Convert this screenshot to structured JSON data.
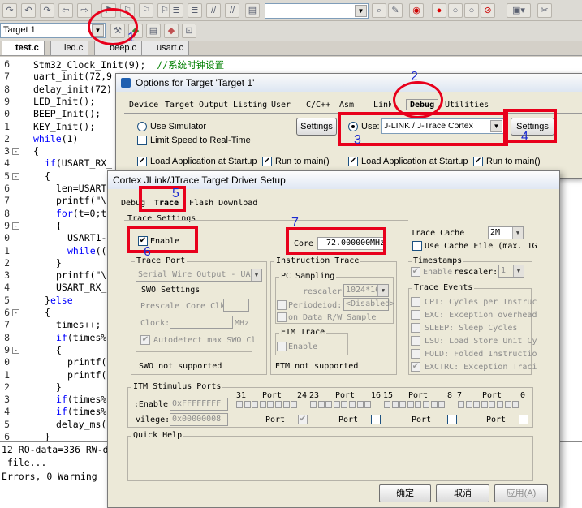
{
  "ide": {
    "target_select": "Target 1",
    "file_tabs": [
      "test.c",
      "led.c",
      "beep.c",
      "usart.c"
    ],
    "active_tab": "test.c",
    "code_lines": [
      {
        "ln": "6",
        "fold": "",
        "pre": "Stm32_Clock_Init(9);  ",
        "cm": "//系统时钟设置"
      },
      {
        "ln": "7",
        "fold": "",
        "pre": "uart_init(72,9",
        "cm": ""
      },
      {
        "ln": "8",
        "fold": "",
        "pre": "delay_init(72)",
        "cm": ""
      },
      {
        "ln": "9",
        "fold": "",
        "pre": "LED_Init();",
        "cm": ""
      },
      {
        "ln": "0",
        "fold": "",
        "pre": "BEEP_Init();",
        "cm": ""
      },
      {
        "ln": "1",
        "fold": "",
        "pre": "KEY_Init();",
        "cm": ""
      },
      {
        "ln": "2",
        "fold": "",
        "kw": "while",
        "pre": "(1)",
        "cm": ""
      },
      {
        "ln": "3",
        "fold": "-",
        "pre": "{",
        "cm": ""
      },
      {
        "ln": "4",
        "fold": "",
        "kw": "if",
        "pre": "(USART_RX_",
        "cm": "",
        "indent": 2
      },
      {
        "ln": "5",
        "fold": "-",
        "pre": "{",
        "cm": "",
        "indent": 2
      },
      {
        "ln": "6",
        "fold": "",
        "pre": "len=USART",
        "cm": "",
        "indent": 4
      },
      {
        "ln": "7",
        "fold": "",
        "pre": "printf(\"\\",
        "cm": "",
        "indent": 4
      },
      {
        "ln": "8",
        "fold": "",
        "kw": "for",
        "pre": "(t=0;t",
        "cm": "",
        "indent": 4
      },
      {
        "ln": "9",
        "fold": "-",
        "pre": "{",
        "cm": "",
        "indent": 4
      },
      {
        "ln": "0",
        "fold": "",
        "pre": "USART1-",
        "cm": "",
        "indent": 6
      },
      {
        "ln": "1",
        "fold": "",
        "kw": "while",
        "pre": "((",
        "cm": "",
        "indent": 6
      },
      {
        "ln": "2",
        "fold": "",
        "pre": "}",
        "cm": "",
        "indent": 4
      },
      {
        "ln": "3",
        "fold": "",
        "pre": "printf(\"\\",
        "cm": "",
        "indent": 4
      },
      {
        "ln": "4",
        "fold": "",
        "pre": "USART_RX_",
        "cm": "",
        "indent": 4
      },
      {
        "ln": "5",
        "fold": "",
        "pre": "}",
        "kw2": "else",
        "cm": "",
        "indent": 2
      },
      {
        "ln": "6",
        "fold": "-",
        "pre": "{",
        "cm": "",
        "indent": 2
      },
      {
        "ln": "7",
        "fold": "",
        "pre": "times++;",
        "cm": "",
        "indent": 4
      },
      {
        "ln": "8",
        "fold": "",
        "kw": "if",
        "pre": "(times%",
        "cm": "",
        "indent": 4
      },
      {
        "ln": "9",
        "fold": "-",
        "pre": "{",
        "cm": "",
        "indent": 4
      },
      {
        "ln": "0",
        "fold": "",
        "pre": "printf(",
        "cm": "",
        "indent": 6
      },
      {
        "ln": "1",
        "fold": "",
        "pre": "printf(",
        "cm": "",
        "indent": 6
      },
      {
        "ln": "2",
        "fold": "",
        "pre": "}",
        "cm": "",
        "indent": 4
      },
      {
        "ln": "3",
        "fold": "",
        "kw": "if",
        "pre": "(times%",
        "cm": "",
        "indent": 4
      },
      {
        "ln": "4",
        "fold": "",
        "kw": "if",
        "pre": "(times%",
        "cm": "",
        "indent": 4
      },
      {
        "ln": "5",
        "fold": "",
        "pre": "delay_ms(",
        "cm": "",
        "indent": 4
      },
      {
        "ln": "6",
        "fold": "",
        "pre": "}",
        "cm": "",
        "indent": 2
      }
    ],
    "build_output": [
      "12 RO-data=336 RW-d",
      " file...",
      "Errors, 0 Warning"
    ]
  },
  "options_dialog": {
    "title": "Options for Target 'Target 1'",
    "tabs": [
      "Device",
      "Target",
      "Output",
      "Listing",
      "User",
      "C/C++",
      "Asm",
      "Linker",
      "Debug",
      "Utilities"
    ],
    "active_tab": "Debug",
    "use_simulator": "Use Simulator",
    "limit_speed": "Limit Speed to Real-Time",
    "settings_left": "Settings",
    "use_label": "Use:",
    "debugger": "J-LINK / J-Trace Cortex",
    "settings_right": "Settings",
    "load_app_left": "Load Application at Startup",
    "run_main_left": "Run to main()",
    "load_app_right": "Load Application at Startup",
    "run_main_right": "Run to main()"
  },
  "jlink_dialog": {
    "title": "Cortex JLink/JTrace Target Driver Setup",
    "tabs": [
      "Debug",
      "Trace",
      "Flash Download"
    ],
    "active_tab": "Trace",
    "trace_settings": "Trace Settings",
    "enable": "Enable",
    "core_label": "Core",
    "core_value": "72.000000",
    "core_unit": "MHz",
    "trace_cache": "Trace Cache",
    "trace_cache_value": "2M",
    "use_cache_file": "Use Cache File (max. 1G",
    "trace_port": "Trace Port",
    "trace_port_value": "Serial Wire Output - UA",
    "swo_settings": "SWO Settings",
    "prescale": "Prescale",
    "core_clk": "Core Clk",
    "clock": "Clock:",
    "mhz": "MHz",
    "autodetect": "Autodetect max SWO Cl",
    "swo_not_supported": "SWO not supported",
    "instruction_trace": "Instruction Trace",
    "pc_sampling": "PC Sampling",
    "prescaler": "rescaler:",
    "prescaler_value": "1024*16",
    "periodic": "Periodeiod:",
    "periodic_value": "<Disabled>",
    "on_data": "on Data R/W Sample",
    "etm_trace": "ETM Trace",
    "etm_enable": "Enable",
    "etm_not_supported": "ETM not supported",
    "timestamps": "Timestamps",
    "ts_enable": "Enable",
    "ts_prescaler": "rescaler:",
    "ts_prescaler_value": "1",
    "trace_events": "Trace Events",
    "events": [
      "CPI: Cycles per Instruc",
      "EXC: Exception overhead",
      "SLEEP: Sleep Cycles",
      "LSU: Load Store Unit Cy",
      "FOLD: Folded Instructio",
      "EXCTRC: Exception Traci"
    ],
    "itm_ports": "ITM Stimulus Ports",
    "enable_row": "Enable:",
    "enable_value": "0xFFFFFFFF",
    "privilege_row": "vilege:",
    "privilege_value": "0x00000008",
    "port_hdr": [
      "31",
      "Port",
      "24",
      "23",
      "Port",
      "16",
      "15",
      "Port",
      "8",
      "7",
      "Port",
      "0"
    ],
    "port_label": "Port",
    "quick_help": "Quick Help",
    "ok": "确定",
    "cancel": "取消",
    "apply": "应用(A)"
  },
  "annotations": [
    "1",
    "2",
    "3",
    "4",
    "5",
    "6",
    "7"
  ],
  "colors": {
    "annotation_red": "#e8001c",
    "annotation_blue": "#1c2bd0"
  }
}
